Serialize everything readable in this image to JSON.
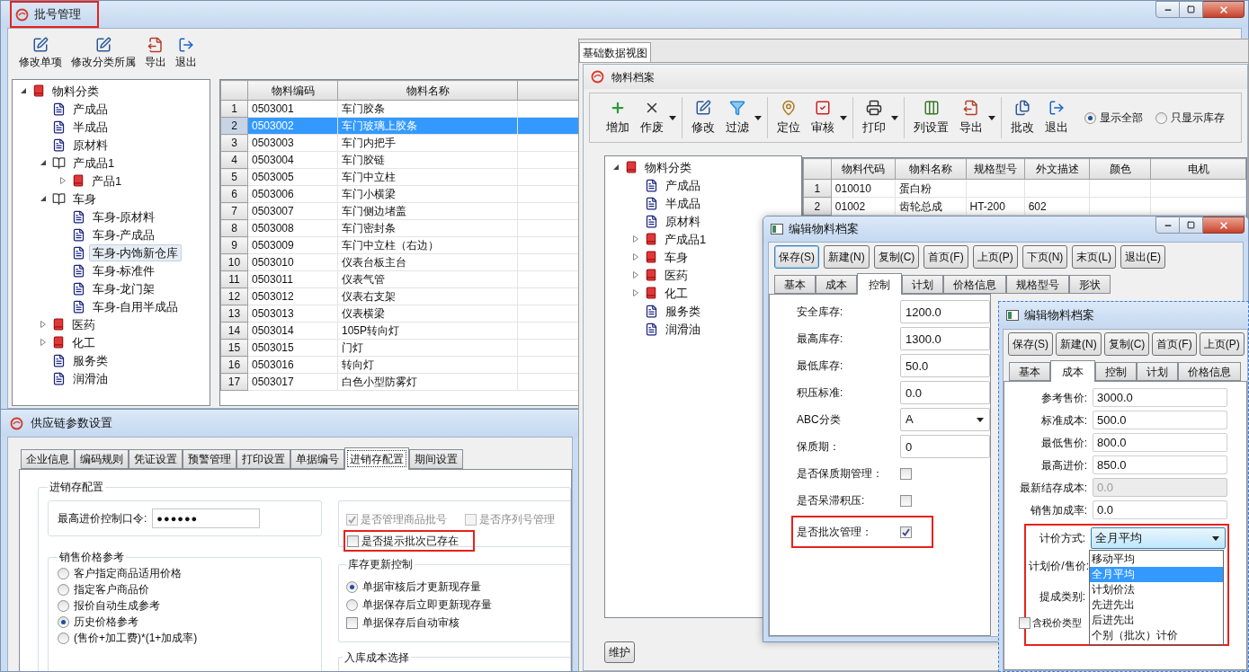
{
  "batch_window": {
    "title": "批号管理",
    "title_highlighted": true,
    "toolbar": [
      "修改单项",
      "修改分类所属",
      "导出",
      "退出"
    ],
    "tree": [
      {
        "label": "物料分类",
        "kind": "book",
        "expanded": true,
        "selected": false,
        "children": [
          {
            "label": "产成品",
            "kind": "doc",
            "selected": false
          },
          {
            "label": "半成品",
            "kind": "doc",
            "selected": false
          },
          {
            "label": "原材料",
            "kind": "doc",
            "selected": false
          },
          {
            "label": "产成品1",
            "kind": "open-book",
            "expanded": true,
            "selected": false,
            "children": [
              {
                "label": "产品1",
                "kind": "book",
                "expanded": false,
                "selected": false
              }
            ]
          },
          {
            "label": "车身",
            "kind": "open-book",
            "expanded": true,
            "selected": false,
            "children": [
              {
                "label": "车身-原材料",
                "kind": "doc",
                "selected": false
              },
              {
                "label": "车身-产成品",
                "kind": "doc",
                "selected": false
              },
              {
                "label": "车身-内饰新仓库",
                "kind": "doc",
                "selected": true
              },
              {
                "label": "车身-标准件",
                "kind": "doc",
                "selected": false
              },
              {
                "label": "车身-龙门架",
                "kind": "doc",
                "selected": false
              },
              {
                "label": "车身-自用半成品",
                "kind": "doc",
                "selected": false
              }
            ]
          },
          {
            "label": "医药",
            "kind": "book",
            "expanded": false,
            "selected": false
          },
          {
            "label": "化工",
            "kind": "book",
            "expanded": false,
            "selected": false
          },
          {
            "label": "服务类",
            "kind": "doc",
            "selected": false
          },
          {
            "label": "润滑油",
            "kind": "doc",
            "selected": false
          }
        ]
      }
    ],
    "grid": {
      "columns": [
        "物料编码",
        "物料名称"
      ],
      "rows": [
        {
          "index": "1",
          "code": "0503001",
          "name": "车门胶条",
          "selected": false
        },
        {
          "index": "2",
          "code": "0503002",
          "name": "车门玻璃上胶条",
          "selected": true
        },
        {
          "index": "3",
          "code": "0503003",
          "name": "车门内把手",
          "selected": false
        },
        {
          "index": "4",
          "code": "0503004",
          "name": "车门胶链",
          "selected": false
        },
        {
          "index": "5",
          "code": "0503005",
          "name": "车门中立柱",
          "selected": false
        },
        {
          "index": "6",
          "code": "0503006",
          "name": "车门小横梁",
          "selected": false
        },
        {
          "index": "7",
          "code": "0503007",
          "name": "车门侧边堵盖",
          "selected": false
        },
        {
          "index": "8",
          "code": "0503008",
          "name": "车门密封条",
          "selected": false
        },
        {
          "index": "9",
          "code": "0503009",
          "name": "车门中立柱（右边）",
          "selected": false
        },
        {
          "index": "10",
          "code": "0503010",
          "name": "仪表台板主台",
          "selected": false
        },
        {
          "index": "11",
          "code": "0503011",
          "name": "仪表气管",
          "selected": false
        },
        {
          "index": "12",
          "code": "0503012",
          "name": "仪表右支架",
          "selected": false
        },
        {
          "index": "13",
          "code": "0503013",
          "name": "仪表横梁",
          "selected": false
        },
        {
          "index": "14",
          "code": "0503014",
          "name": "105P转向灯",
          "selected": false
        },
        {
          "index": "15",
          "code": "0503015",
          "name": "门灯",
          "selected": false
        },
        {
          "index": "16",
          "code": "0503016",
          "name": "转向灯",
          "selected": false
        },
        {
          "index": "17",
          "code": "0503017",
          "name": "白色小型防雾灯",
          "selected": false
        }
      ]
    }
  },
  "settings_window": {
    "title": "供应链参数设置",
    "tabs": [
      {
        "label": "企业信息",
        "selected": false
      },
      {
        "label": "编码规则",
        "selected": false
      },
      {
        "label": "凭证设置",
        "selected": false
      },
      {
        "label": "预警管理",
        "selected": false
      },
      {
        "label": "打印设置",
        "selected": false
      },
      {
        "label": "单据编号",
        "selected": false
      },
      {
        "label": "进销存配置",
        "selected": true
      },
      {
        "label": "期间设置",
        "selected": false
      }
    ],
    "group_title": "进销存配置",
    "password": {
      "label": "最高进价控制口令:",
      "value": "●●●●●●"
    },
    "price_reference": {
      "title": "销售价格参考",
      "options": [
        {
          "label": "客户指定商品适用价格",
          "selected": false
        },
        {
          "label": "指定客户商品价",
          "selected": false
        },
        {
          "label": "报价自动生成参考",
          "selected": false
        },
        {
          "label": "历史价格参考",
          "selected": true
        },
        {
          "label": "(售价+加工费)*(1+加成率)",
          "selected": false
        }
      ]
    },
    "batch_options": [
      {
        "label": "是否管理商品批号",
        "checked": true,
        "disabled": true,
        "highlighted": false
      },
      {
        "label": "是否序列号管理",
        "checked": false,
        "disabled": true,
        "highlighted": false
      },
      {
        "label": "是否提示批次已存在",
        "checked": false,
        "disabled": false,
        "highlighted": true
      }
    ],
    "stock_update": {
      "title": "库存更新控制",
      "options": [
        {
          "kind": "radio",
          "label": "单据审核后才更新现存量",
          "selected": true
        },
        {
          "kind": "radio",
          "label": "单据保存后立即更新现存量",
          "selected": false
        },
        {
          "kind": "checkbox",
          "label": "单据保存后自动审核",
          "checked": false
        }
      ]
    },
    "cost_title": "入库成本选择"
  },
  "data_view": {
    "tab": "基础数据视图",
    "title": "物料档案",
    "toolbar": [
      [
        {
          "label": "增加",
          "dropdown": false
        },
        {
          "label": "作废",
          "dropdown": true
        }
      ],
      [
        {
          "label": "修改",
          "dropdown": false
        },
        {
          "label": "过滤",
          "dropdown": true
        }
      ],
      [
        {
          "label": "定位",
          "dropdown": false
        },
        {
          "label": "审核",
          "dropdown": true
        }
      ],
      [
        {
          "label": "打印",
          "dropdown": true
        }
      ],
      [
        {
          "label": "列设置",
          "dropdown": false
        },
        {
          "label": "导出",
          "dropdown": true
        }
      ],
      [
        {
          "label": "批改",
          "dropdown": false
        },
        {
          "label": "退出",
          "dropdown": false
        }
      ]
    ],
    "filters": [
      {
        "label": "显示全部",
        "selected": true
      },
      {
        "label": "只显示库存",
        "selected": false
      }
    ],
    "tree": [
      {
        "label": "物料分类",
        "kind": "book",
        "expanded": true,
        "children": [
          {
            "label": "产成品",
            "kind": "doc"
          },
          {
            "label": "半成品",
            "kind": "doc"
          },
          {
            "label": "原材料",
            "kind": "doc"
          },
          {
            "label": "产成品1",
            "kind": "book",
            "expanded": false
          },
          {
            "label": "车身",
            "kind": "book",
            "expanded": false
          },
          {
            "label": "医药",
            "kind": "book",
            "expanded": false
          },
          {
            "label": "化工",
            "kind": "book",
            "expanded": false
          },
          {
            "label": "服务类",
            "kind": "doc"
          },
          {
            "label": "润滑油",
            "kind": "doc"
          }
        ]
      }
    ],
    "grid": {
      "columns": [
        "物料代码",
        "物料名称",
        "规格型号",
        "外文描述",
        "颜色",
        "电机"
      ],
      "rows": [
        {
          "index": "1",
          "cells": [
            "010010",
            "蛋白粉"
          ]
        },
        {
          "index": "2",
          "cells": [
            "01002",
            "齿轮总成",
            "HT-200",
            "602"
          ]
        }
      ]
    },
    "button": "维护"
  },
  "edit_control": {
    "title": "编辑物料档案",
    "buttons": [
      {
        "label": "保存(S)",
        "focused": true
      },
      {
        "label": "新建(N)",
        "focused": false
      },
      {
        "label": "复制(C)",
        "focused": false
      },
      {
        "label": "首页(F)",
        "focused": false
      },
      {
        "label": "上页(P)",
        "focused": false
      },
      {
        "label": "下页(N)",
        "focused": false
      },
      {
        "label": "末页(L)",
        "focused": false
      },
      {
        "label": "退出(E)",
        "focused": false
      }
    ],
    "tabs": [
      {
        "label": "基本",
        "selected": false
      },
      {
        "label": "成本",
        "selected": false
      },
      {
        "label": "控制",
        "selected": true
      },
      {
        "label": "计划",
        "selected": false
      },
      {
        "label": "价格信息",
        "selected": false
      },
      {
        "label": "规格型号",
        "selected": false
      },
      {
        "label": "形状",
        "selected": false
      }
    ],
    "fields": [
      {
        "kind": "text",
        "label": "安全库存:",
        "value": "1200.0"
      },
      {
        "kind": "text",
        "label": "最高库存:",
        "value": "1300.0"
      },
      {
        "kind": "text",
        "label": "最低库存:",
        "value": "50.0"
      },
      {
        "kind": "text",
        "label": "积压标准:",
        "value": "0.0"
      },
      {
        "kind": "select",
        "label": "ABC分类",
        "value": "A"
      },
      {
        "kind": "text",
        "label": "保质期：",
        "value": "0"
      },
      {
        "kind": "checkbox",
        "label": "是否保质期管理：",
        "checked": false,
        "highlighted": false
      },
      {
        "kind": "checkbox",
        "label": "是否呆滞积压:",
        "checked": false,
        "highlighted": false
      },
      {
        "kind": "checkbox",
        "label": "是否批次管理：",
        "checked": true,
        "highlighted": true
      }
    ]
  },
  "edit_cost": {
    "title": "编辑物料档案",
    "buttons": [
      {
        "label": "保存(S)",
        "focused": false
      },
      {
        "label": "新建(N)",
        "focused": false
      },
      {
        "label": "复制(C)",
        "focused": false
      },
      {
        "label": "首页(F)",
        "focused": false
      },
      {
        "label": "上页(P)",
        "focused": false
      }
    ],
    "tabs": [
      {
        "label": "基本",
        "selected": false
      },
      {
        "label": "成本",
        "selected": true
      },
      {
        "label": "控制",
        "selected": false
      },
      {
        "label": "计划",
        "selected": false
      },
      {
        "label": "价格信息",
        "selected": false
      }
    ],
    "fields": [
      {
        "label": "参考售价:",
        "value": "3000.0",
        "disabled": false
      },
      {
        "label": "标准成本:",
        "value": "500.0",
        "disabled": false
      },
      {
        "label": "最低售价:",
        "value": "800.0",
        "disabled": false
      },
      {
        "label": "最高进价:",
        "value": "850.0",
        "disabled": false
      },
      {
        "label": "最新结存成本:",
        "value": "0.0",
        "disabled": true
      },
      {
        "label": "销售加成率:",
        "value": "0.0",
        "disabled": false
      }
    ],
    "pricing": {
      "highlighted": true,
      "label": "计价方式:",
      "value": "全月平均",
      "open": true,
      "options": [
        {
          "label": "移动平均",
          "selected": false
        },
        {
          "label": "全月平均",
          "selected": true
        },
        {
          "label": "计划价法",
          "selected": false
        },
        {
          "label": "先进先出",
          "selected": false
        },
        {
          "label": "后进先出",
          "selected": false
        },
        {
          "label": "个别（批次）计价",
          "selected": false
        }
      ],
      "plan_price_label": "计划价/售价:",
      "commission_label": "提成类别:",
      "tax_type": {
        "label": "含税价类型",
        "checked": false
      }
    }
  }
}
